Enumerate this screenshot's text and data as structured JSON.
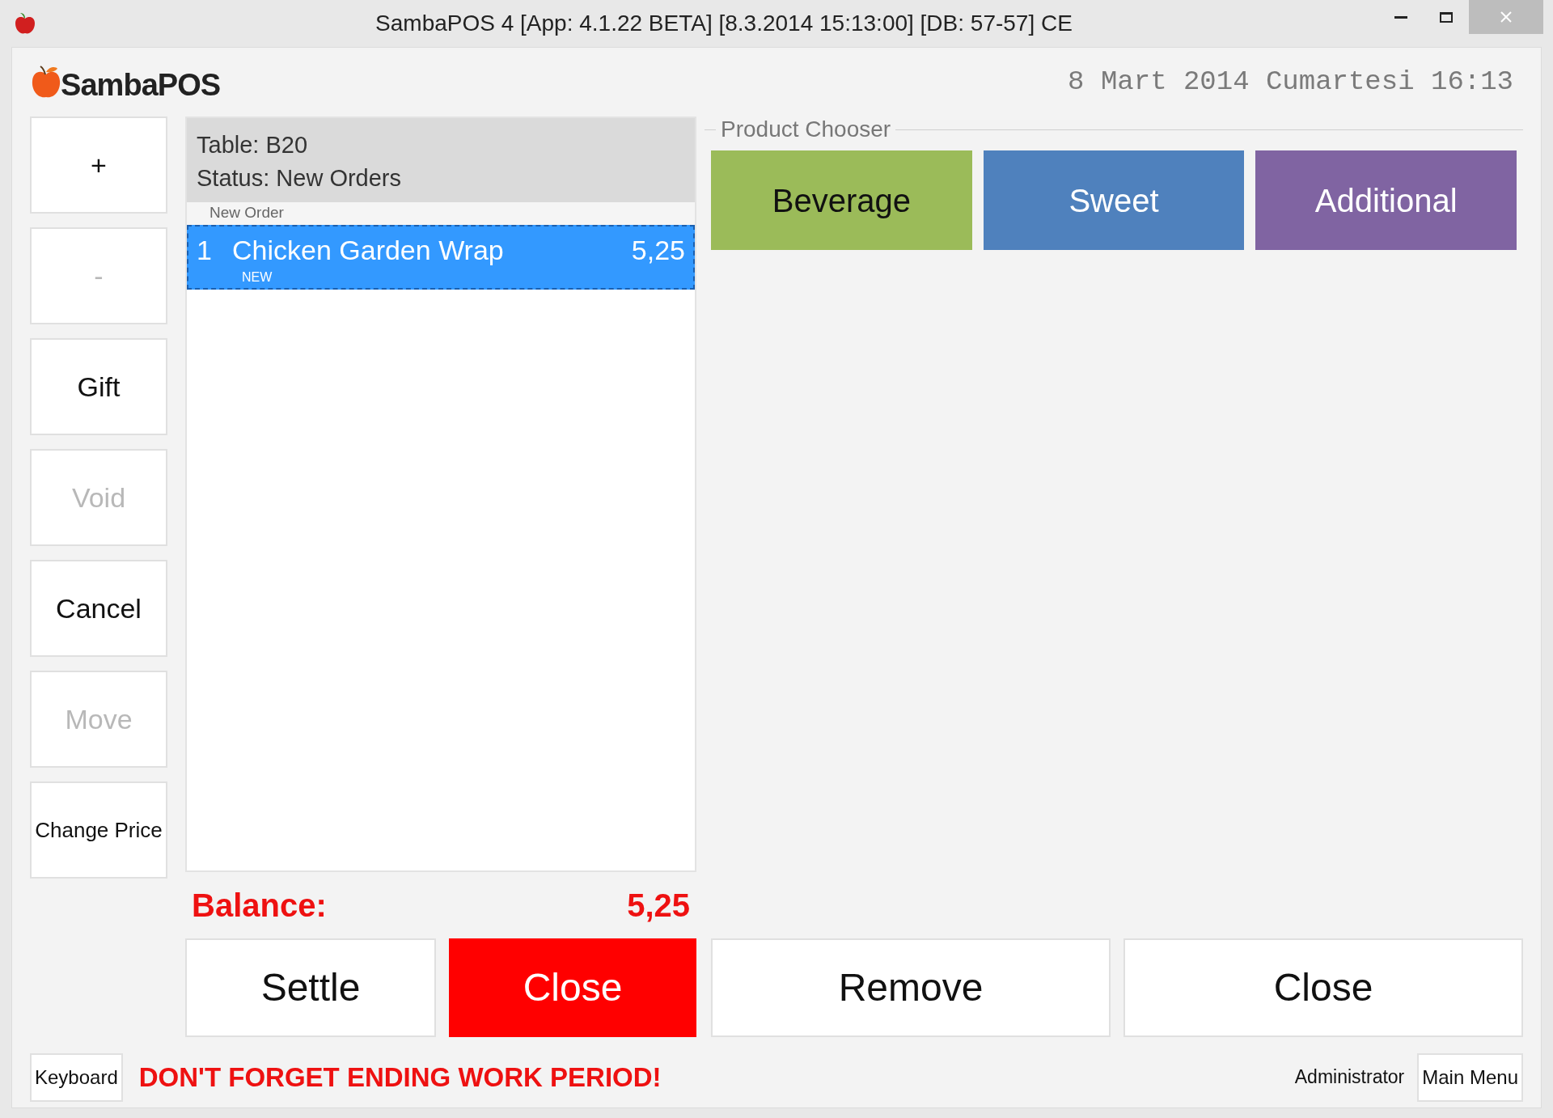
{
  "window": {
    "title": "SambaPOS 4 [App: 4.1.22 BETA] [8.3.2014 15:13:00] [DB: 57-57] CE"
  },
  "header": {
    "logo": "SambaPOS",
    "datetime": "8 Mart 2014 Cumartesi 16:13"
  },
  "command_buttons": [
    {
      "label": "+",
      "disabled": false
    },
    {
      "label": "-",
      "disabled": true
    },
    {
      "label": "Gift",
      "disabled": false
    },
    {
      "label": "Void",
      "disabled": true
    },
    {
      "label": "Cancel",
      "disabled": false
    },
    {
      "label": "Move",
      "disabled": true
    },
    {
      "label": "Change Price",
      "disabled": false
    }
  ],
  "ticket": {
    "lines": [
      "Table: B20",
      "Status: New Orders"
    ],
    "group_label": "New Order",
    "orders": [
      {
        "quantity": "1",
        "name": "Chicken Garden Wrap",
        "price": "5,25",
        "tag": "NEW",
        "selected": true
      }
    ],
    "balance_label": "Balance:",
    "balance": "5,25"
  },
  "ticket_buttons": [
    {
      "label": "Settle",
      "kind": "normal"
    },
    {
      "label": "Close",
      "kind": "alert"
    }
  ],
  "product_chooser": {
    "title": "Product Chooser",
    "categories": [
      {
        "label": "Beverage",
        "color": "#9bbb59"
      },
      {
        "label": "Sweet",
        "color": "#4f81bd"
      },
      {
        "label": "Additional",
        "color": "#8064a2"
      }
    ],
    "buttons": [
      "Remove",
      "Close"
    ]
  },
  "footer": {
    "keyboard": "Keyboard",
    "notice": "DON'T FORGET ENDING WORK PERIOD!",
    "user": "Administrator",
    "main_menu": "Main Menu"
  }
}
